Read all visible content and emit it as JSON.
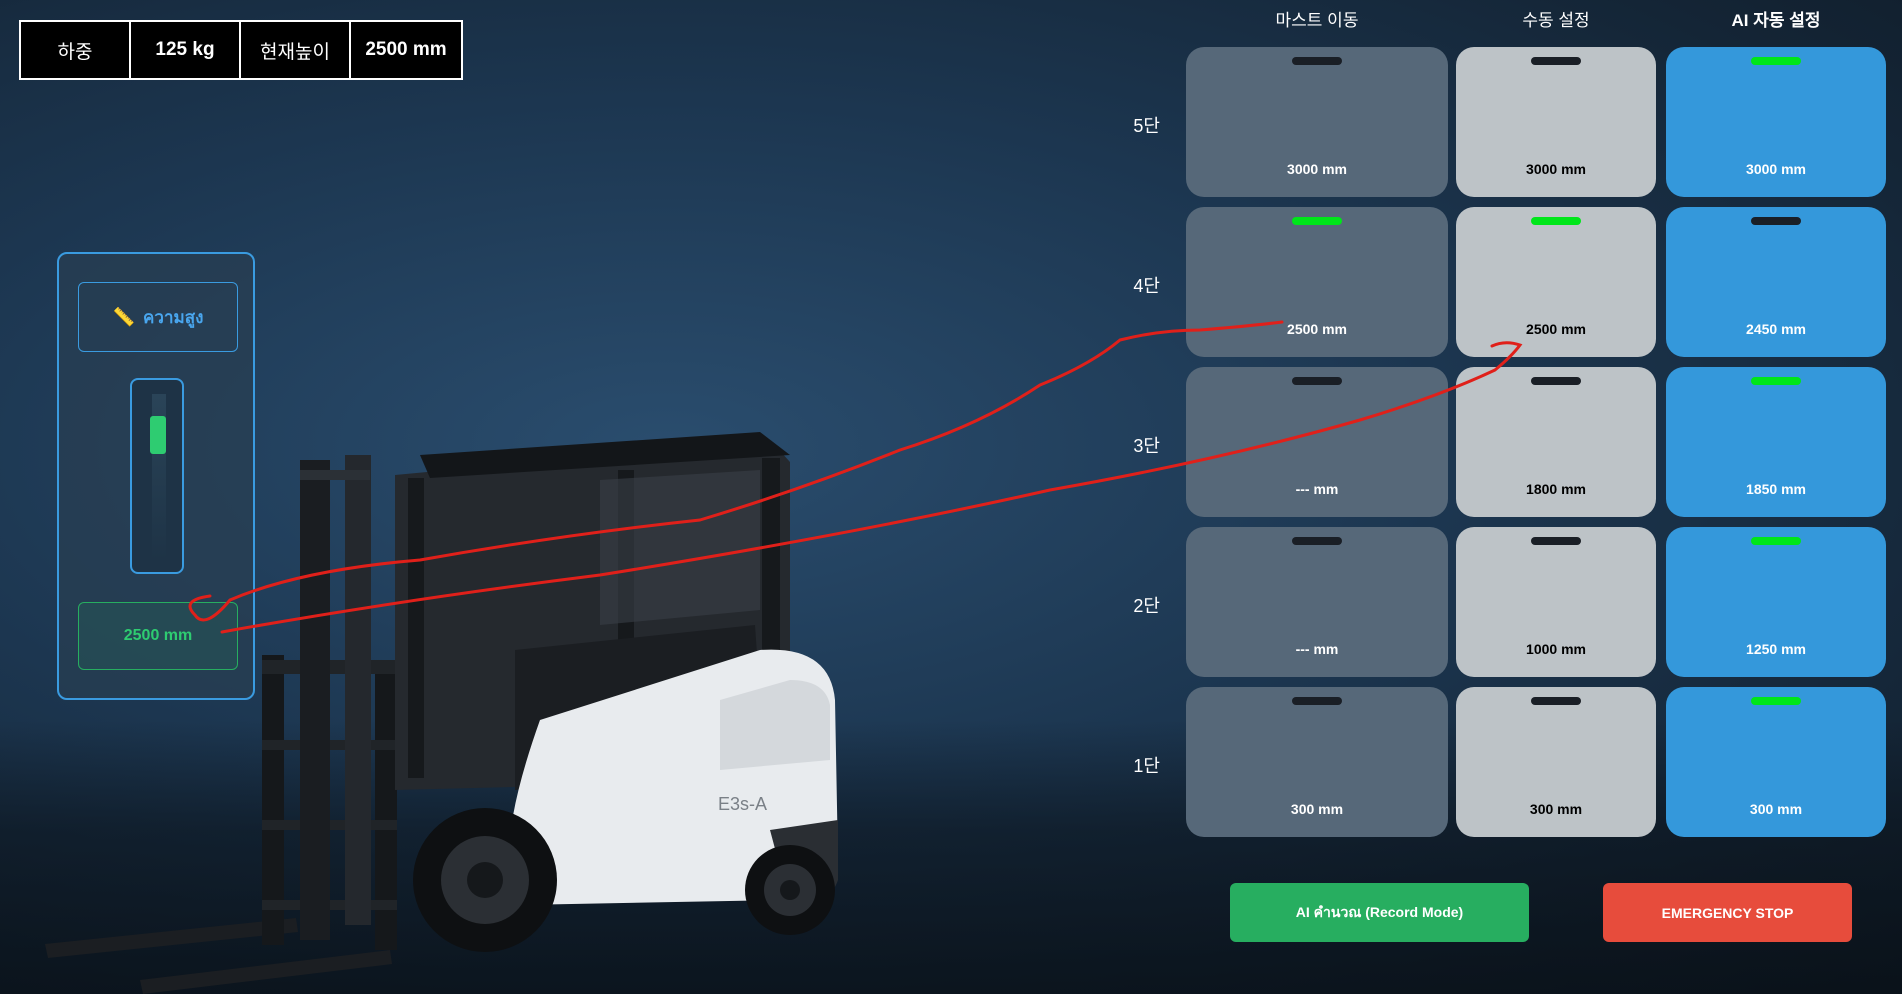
{
  "info": {
    "load_label": "하중",
    "load_value": "125 kg",
    "height_label": "현재높이",
    "height_value": "2500 mm"
  },
  "height_panel": {
    "title": "ความสูง",
    "readout": "2500 mm",
    "gauge_level": 0.833
  },
  "columns": [
    "마스트 이동",
    "수동 설정",
    "AI 자동 설정"
  ],
  "rows": [
    "5단",
    "4단",
    "3단",
    "2단",
    "1단"
  ],
  "grid": {
    "mast": [
      {
        "value": "3000 mm",
        "active": false
      },
      {
        "value": "2500 mm",
        "active": true
      },
      {
        "value": "--- mm",
        "active": false
      },
      {
        "value": "--- mm",
        "active": false
      },
      {
        "value": "300 mm",
        "active": false
      }
    ],
    "manual": [
      {
        "value": "3000 mm",
        "active": false
      },
      {
        "value": "2500 mm",
        "active": true
      },
      {
        "value": "1800 mm",
        "active": false
      },
      {
        "value": "1000 mm",
        "active": false
      },
      {
        "value": "300 mm",
        "active": false
      }
    ],
    "ai": [
      {
        "value": "3000 mm",
        "active": true
      },
      {
        "value": "2450 mm",
        "active": false
      },
      {
        "value": "1850 mm",
        "active": true
      },
      {
        "value": "1250 mm",
        "active": true
      },
      {
        "value": "300 mm",
        "active": true
      }
    ]
  },
  "buttons": {
    "ai_record": "AI คำนวณ (Record Mode)",
    "emergency": "EMERGENCY STOP"
  },
  "colors": {
    "indicator_on": "#00e61a",
    "ai_button": "#27ae60",
    "emergency": "#e74c3c",
    "ai_card": "#3498db",
    "annotation": "#e0201a"
  },
  "vehicle_label": "E3s-A"
}
